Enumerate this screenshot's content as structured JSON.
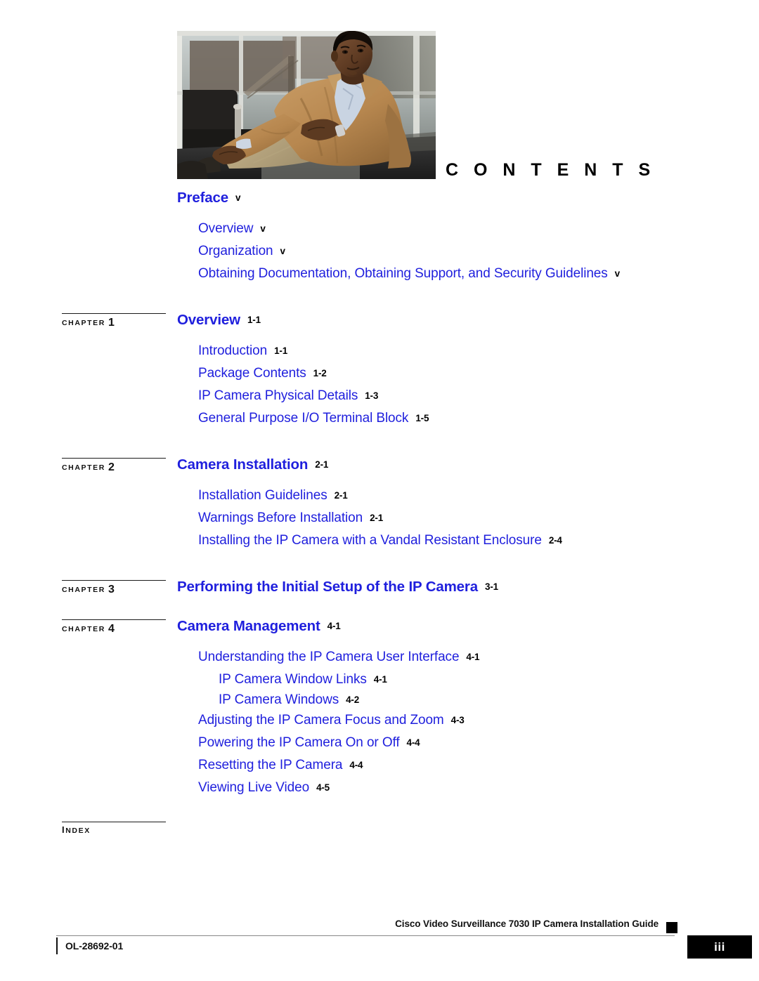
{
  "page": {
    "heading": "C O N T E N T S",
    "hero_alt": "seated-man-photo"
  },
  "toc": {
    "groups": [
      {
        "marker": null,
        "entries": [
          {
            "level": 0,
            "label": "Preface",
            "page": "v"
          },
          {
            "level": 1,
            "label": "Overview",
            "page": "v"
          },
          {
            "level": 1,
            "label": "Organization",
            "page": "v"
          },
          {
            "level": 1,
            "label": "Obtaining Documentation, Obtaining Support, and Security Guidelines",
            "page": "v"
          }
        ]
      },
      {
        "marker": {
          "word": "CHAPTER",
          "number": "1"
        },
        "entries": [
          {
            "level": 0,
            "label": "Overview",
            "page": "1-1"
          },
          {
            "level": 1,
            "label": "Introduction",
            "page": "1-1"
          },
          {
            "level": 1,
            "label": "Package Contents",
            "page": "1-2"
          },
          {
            "level": 1,
            "label": "IP Camera Physical Details",
            "page": "1-3"
          },
          {
            "level": 1,
            "label": "General Purpose I/O Terminal Block",
            "page": "1-5"
          }
        ]
      },
      {
        "marker": {
          "word": "CHAPTER",
          "number": "2"
        },
        "entries": [
          {
            "level": 0,
            "label": "Camera Installation",
            "page": "2-1"
          },
          {
            "level": 1,
            "label": "Installation Guidelines",
            "page": "2-1"
          },
          {
            "level": 1,
            "label": "Warnings Before Installation",
            "page": "2-1"
          },
          {
            "level": 1,
            "label": "Installing the IP Camera with a Vandal Resistant Enclosure",
            "page": "2-4"
          }
        ]
      },
      {
        "marker": {
          "word": "CHAPTER",
          "number": "3"
        },
        "entries": [
          {
            "level": 0,
            "label": "Performing the Initial Setup of the IP Camera",
            "page": "3-1"
          }
        ]
      },
      {
        "marker": {
          "word": "CHAPTER",
          "number": "4"
        },
        "entries": [
          {
            "level": 0,
            "label": "Camera Management",
            "page": "4-1"
          },
          {
            "level": 1,
            "label": "Understanding the IP Camera User Interface",
            "page": "4-1"
          },
          {
            "level": 2,
            "label": "IP Camera Window Links",
            "page": "4-1"
          },
          {
            "level": 2,
            "label": "IP Camera Windows",
            "page": "4-2"
          },
          {
            "level": 1,
            "label": "Adjusting the IP Camera Focus and Zoom",
            "page": "4-3"
          },
          {
            "level": 1,
            "label": "Powering the IP Camera On or Off",
            "page": "4-4"
          },
          {
            "level": 1,
            "label": "Resetting the IP Camera",
            "page": "4-4"
          },
          {
            "level": 1,
            "label": "Viewing Live Video",
            "page": "4-5"
          }
        ]
      }
    ],
    "index_label": "INDEX"
  },
  "footer": {
    "title": "Cisco Video Surveillance 7030 IP Camera Installation Guide",
    "doc_number": "OL-28692-01",
    "page_number": "iii"
  },
  "colors": {
    "link_blue": "#1f1fdd",
    "text_black": "#111111",
    "rule_gray": "#888888"
  }
}
